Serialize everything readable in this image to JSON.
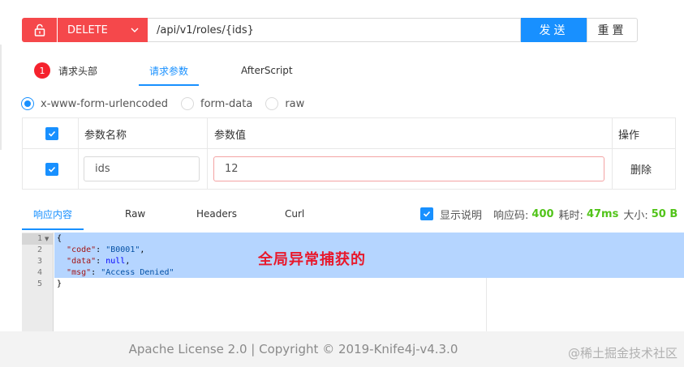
{
  "request": {
    "method": "DELETE",
    "url": "/api/v1/roles/{ids}",
    "send_label": "发送",
    "reset_label": "重置"
  },
  "request_tabs": {
    "headers_badge": "1",
    "headers_label": "请求头部",
    "params_label": "请求参数",
    "afterscript_label": "AfterScript"
  },
  "body_types": {
    "urlencoded": "x-www-form-urlencoded",
    "formdata": "form-data",
    "raw": "raw"
  },
  "params_table": {
    "col_name": "参数名称",
    "col_value": "参数值",
    "col_action": "操作",
    "rows": [
      {
        "checked": true,
        "name": "ids",
        "value": "12",
        "action": "删除"
      }
    ]
  },
  "response_tabs": {
    "content": "响应内容",
    "raw": "Raw",
    "headers": "Headers",
    "curl": "Curl"
  },
  "response_meta": {
    "show_desc_label": "显示说明",
    "status_label": "响应码:",
    "status_value": "400",
    "time_label": "耗时:",
    "time_value": "47ms",
    "size_label": "大小:",
    "size_value": "50 B"
  },
  "editor": {
    "line_numbers": [
      "1",
      "2",
      "3",
      "4",
      "5"
    ],
    "line1": "{",
    "line2_key": "\"code\"",
    "line2_val": "\"B0001\"",
    "line3_key": "\"data\"",
    "line3_val": "null",
    "line4_key": "\"msg\"",
    "line4_val": "\"Access Denied\"",
    "line5": "}"
  },
  "annotation": "全局异常捕获的",
  "footer": {
    "license": "Apache License 2.0 | Copyright",
    "copyright_symbol": "©",
    "year": "2019-",
    "version": "Knife4j-v4.3.0"
  },
  "watermark": "@稀土掘金技术社区",
  "colors": {
    "primary": "#1890ff",
    "danger": "#f5484b",
    "success": "#52c41a",
    "annotation": "#e8192c"
  }
}
